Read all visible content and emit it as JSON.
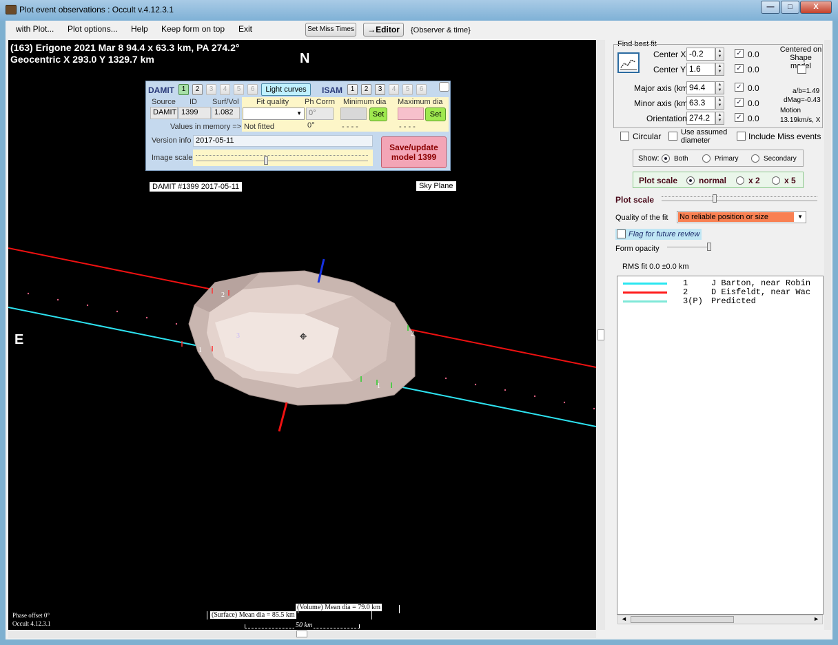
{
  "window": {
    "title": "Plot event observations : Occult v.4.12.3.1",
    "buttons": {
      "minimize": "—",
      "maximize": "□",
      "close": "X"
    }
  },
  "menu": {
    "items": [
      "with Plot...",
      "Plot options...",
      "Help",
      "Keep form on top",
      "Exit"
    ],
    "set_miss_times": "Set Miss Times",
    "editor": "→Editor",
    "observer_time": "{Observer & time}"
  },
  "plot": {
    "header_line1": "(163) Erigone  2021 Mar 8   94.4 x 63.3 km,  PA 274.2°",
    "header_line2": "Geocentric  X  293.0  Y  1329.7 km",
    "north_label": "N",
    "east_label": "E",
    "chord_labels": [
      "1",
      "2",
      "2",
      "1",
      "3"
    ],
    "phase_offset": "Phase offset 0°",
    "version": "Occult 4.12.3.1",
    "volume_dia": "(Volume) Mean dia = 79.0 km",
    "surface_dia": "(Surface) Mean dia = 85.5 km",
    "scale_bar": "50 km",
    "damit_tag": "DAMIT #1399 2017-05-11",
    "sky_plane_tag": "Sky Plane"
  },
  "overlay": {
    "damit_title": "DAMIT",
    "damit_nums": [
      "1",
      "2",
      "3",
      "4",
      "5",
      "6"
    ],
    "light_curves": "Light curves",
    "isam_title": "ISAM",
    "isam_nums": [
      "1",
      "2",
      "3",
      "4",
      "5",
      "6"
    ],
    "col_source": "Source",
    "col_id": "ID",
    "col_surfvol": "Surf/Vol",
    "val_source": "DAMIT",
    "val_id": "1399",
    "val_surfvol": "1.082",
    "fit_quality": "Fit quality",
    "ph_corrn": "Ph Corrn",
    "min_dia": "Minimum dia",
    "max_dia": "Maximum dia",
    "ph_corrn_val": "0°",
    "set_label": "Set",
    "values_in_memory": "Values in memory =>",
    "not_fitted": "Not fitted",
    "mem_ph": "0°",
    "mem_min": "- - - -",
    "mem_max": "- - - -",
    "version_info_label": "Version info",
    "version_info_val": "2017-05-11",
    "image_scale_label": "Image scale",
    "save_update": "Save/update model 1399"
  },
  "fit": {
    "find_best_fit": "Find best fit",
    "center_x_label": "Center X",
    "center_x": "-0.2",
    "center_y_label": "Center Y",
    "center_y": "1.6",
    "major_label": "Major axis (km)",
    "major": "94.4",
    "minor_label": "Minor axis (km)",
    "minor": "63.3",
    "orient_label": "Orientation",
    "orient": "274.2",
    "residuals": [
      "0.0",
      "0.0",
      "0.0",
      "0.0",
      "0.0"
    ],
    "centered_on": "Centered on Shape model",
    "ab": "a/b=1.49",
    "dmag": "dMag=-0.43",
    "motion_label": "Motion",
    "motion_val": "13.19km/s, X",
    "circular": "Circular",
    "use_assumed": "Use assumed diameter",
    "include_miss": "Include Miss events",
    "show_label": "Show:",
    "show_both": "Both",
    "show_primary": "Primary",
    "show_secondary": "Secondary",
    "plot_scale_label": "Plot scale",
    "scale_normal": "normal",
    "scale_x2": "x 2",
    "scale_x5": "x 5",
    "plot_scale_slider_label": "Plot scale",
    "quality_label": "Quality of the fit",
    "quality_value": "No reliable position or size",
    "flag_review": "Flag for future review",
    "form_opacity": "Form opacity",
    "rms_fit": "RMS fit 0.0 ±0.0 km"
  },
  "legend": [
    {
      "color": "#29e6f0",
      "num": "1",
      "name": "J Barton, near Robin"
    },
    {
      "color": "#ff1a1a",
      "num": "2",
      "name": "D Eisfeldt, near Wac"
    },
    {
      "color": "#7fe8d8",
      "num": "3(P)",
      "name": "Predicted"
    }
  ],
  "colors": {
    "accent_red": "#e11",
    "accent_cyan": "#2de2f0",
    "shape_fill": "#d8c6c0"
  }
}
